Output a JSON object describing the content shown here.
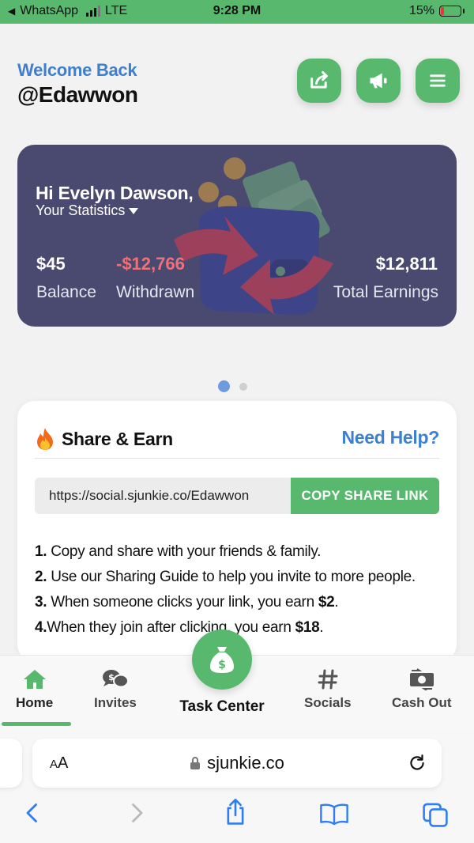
{
  "status_bar": {
    "back_app": "WhatsApp",
    "network": "LTE",
    "time": "9:28 PM",
    "battery": "15%",
    "battery_level": 0.15
  },
  "header": {
    "welcome": "Welcome Back",
    "username": "@Edawwon",
    "buttons": [
      "share-icon",
      "megaphone-icon",
      "menu-icon"
    ]
  },
  "stats": {
    "greeting": "Hi Evelyn Dawson,",
    "dropdown_label": "Your Statistics",
    "balance_value": "$45",
    "balance_label": "Balance",
    "withdrawn_value": "-$12,766",
    "withdrawn_label": "Withdrawn",
    "total_value": "$12,811",
    "total_label": "Total Earnings",
    "colors": {
      "card": "#4a4a70",
      "negative": "#f0707a"
    }
  },
  "carousel": {
    "active_index": 0,
    "count": 2
  },
  "share": {
    "title": "Share & Earn",
    "help": "Need Help?",
    "link": "https://social.sjunkie.co/Edawwon",
    "copy_button": "COPY SHARE LINK",
    "steps": [
      {
        "num": "1.",
        "text": " Copy and share with your friends & family.",
        "bold": "",
        "end": ""
      },
      {
        "num": "2.",
        "text": " Use our Sharing Guide to help you invite to more people.",
        "bold": "",
        "end": ""
      },
      {
        "num": "3.",
        "text": " When someone clicks your link, you earn ",
        "bold": "$2",
        "end": "."
      },
      {
        "num": "4.",
        "text": "When they join after clicking, you earn ",
        "bold": "$18",
        "end": "."
      }
    ]
  },
  "tabs": {
    "home": "Home",
    "invites": "Invites",
    "task_center": "Task Center",
    "socials": "Socials",
    "cashout": "Cash Out",
    "active": "home"
  },
  "browser": {
    "text_size": "AA",
    "domain": "sjunkie.co"
  },
  "colors": {
    "accent": "#57b86e",
    "link_blue": "#3f7fd0"
  }
}
